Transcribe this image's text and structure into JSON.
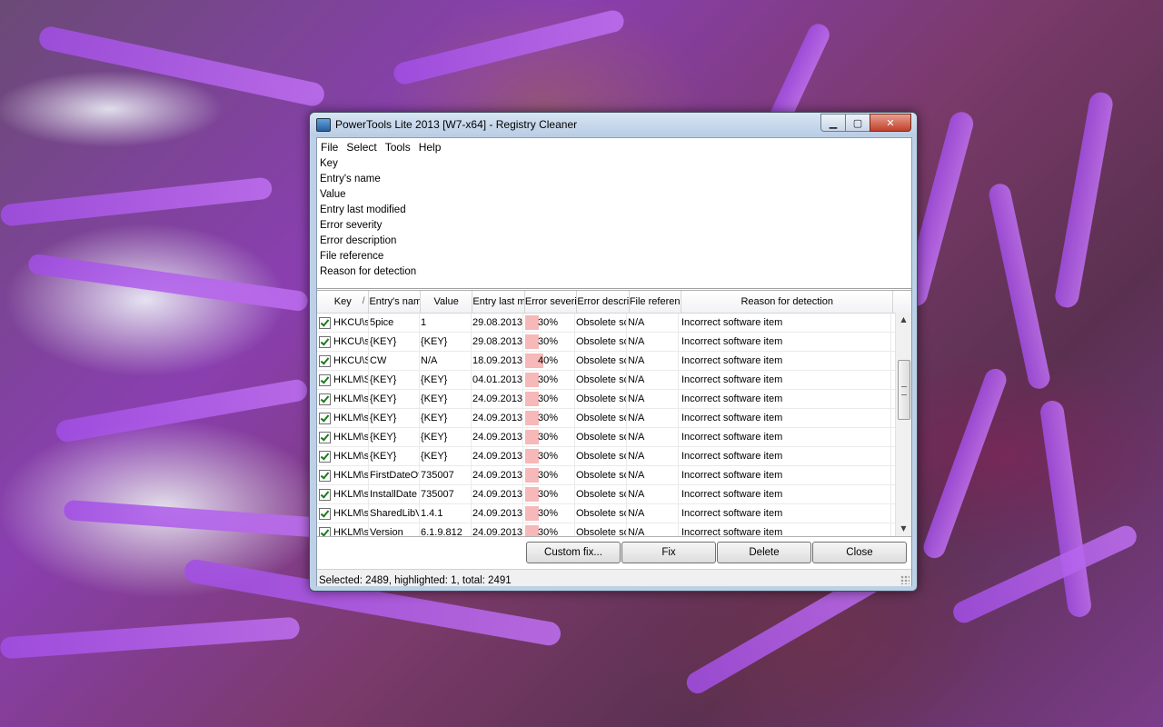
{
  "window": {
    "title": "PowerTools Lite 2013 [W7-x64] - Registry Cleaner",
    "minimize": "▁",
    "maximize": "▢",
    "close": "✕"
  },
  "menu": [
    {
      "label": "File"
    },
    {
      "label": "Select"
    },
    {
      "label": "Tools"
    },
    {
      "label": "Help"
    }
  ],
  "details": [
    "Key",
    "Entry's name",
    "Value",
    "Entry last modified",
    "Error severity",
    "Error description",
    "File reference",
    "Reason for detection"
  ],
  "grid": {
    "columns": [
      {
        "label": "Key",
        "sorted": true
      },
      {
        "label": "Entry's name"
      },
      {
        "label": "Value"
      },
      {
        "label": "Entry last modified"
      },
      {
        "label": "Error severity"
      },
      {
        "label": "Error description"
      },
      {
        "label": "File reference"
      },
      {
        "label": "Reason for detection"
      }
    ],
    "sort_arrow": "/",
    "rows": [
      {
        "key": "HKCU\\software",
        "name": "5pice",
        "value": "1",
        "modified": "29.08.2013",
        "severity": "30%",
        "severity_pct": 30,
        "desc": "Obsolete software",
        "file": "N/A",
        "reason": "Incorrect software item"
      },
      {
        "key": "HKCU\\software",
        "name": "{KEY}",
        "value": "{KEY}",
        "modified": "29.08.2013",
        "severity": "30%",
        "severity_pct": 30,
        "desc": "Obsolete software",
        "file": "N/A",
        "reason": "Incorrect software item"
      },
      {
        "key": "HKCU\\Software",
        "name": "CW",
        "value": "N/A",
        "modified": "18.09.2013",
        "severity": "40%",
        "severity_pct": 40,
        "desc": "Obsolete software",
        "file": "N/A",
        "reason": "Incorrect software item"
      },
      {
        "key": "HKLM\\Software",
        "name": "{KEY}",
        "value": "{KEY}",
        "modified": "04.01.2013",
        "severity": "30%",
        "severity_pct": 30,
        "desc": "Obsolete software",
        "file": "N/A",
        "reason": "Incorrect software item"
      },
      {
        "key": "HKLM\\software",
        "name": "{KEY}",
        "value": "{KEY}",
        "modified": "24.09.2013",
        "severity": "30%",
        "severity_pct": 30,
        "desc": "Obsolete software",
        "file": "N/A",
        "reason": "Incorrect software item"
      },
      {
        "key": "HKLM\\software",
        "name": "{KEY}",
        "value": "{KEY}",
        "modified": "24.09.2013",
        "severity": "30%",
        "severity_pct": 30,
        "desc": "Obsolete software",
        "file": "N/A",
        "reason": "Incorrect software item"
      },
      {
        "key": "HKLM\\software",
        "name": "{KEY}",
        "value": "{KEY}",
        "modified": "24.09.2013",
        "severity": "30%",
        "severity_pct": 30,
        "desc": "Obsolete software",
        "file": "N/A",
        "reason": "Incorrect software item"
      },
      {
        "key": "HKLM\\software",
        "name": "{KEY}",
        "value": "{KEY}",
        "modified": "24.09.2013",
        "severity": "30%",
        "severity_pct": 30,
        "desc": "Obsolete software",
        "file": "N/A",
        "reason": "Incorrect software item"
      },
      {
        "key": "HKLM\\software",
        "name": "FirstDateOfUse",
        "value": "735007",
        "modified": "24.09.2013",
        "severity": "30%",
        "severity_pct": 30,
        "desc": "Obsolete software",
        "file": "N/A",
        "reason": "Incorrect software item"
      },
      {
        "key": "HKLM\\software",
        "name": "InstallDate",
        "value": "735007",
        "modified": "24.09.2013",
        "severity": "30%",
        "severity_pct": 30,
        "desc": "Obsolete software",
        "file": "N/A",
        "reason": "Incorrect software item"
      },
      {
        "key": "HKLM\\software",
        "name": "SharedLibVersion",
        "value": "1.4.1",
        "modified": "24.09.2013",
        "severity": "30%",
        "severity_pct": 30,
        "desc": "Obsolete software",
        "file": "N/A",
        "reason": "Incorrect software item"
      },
      {
        "key": "HKLM\\software",
        "name": "Version",
        "value": "6.1.9.812",
        "modified": "24.09.2013",
        "severity": "30%",
        "severity_pct": 30,
        "desc": "Obsolete software",
        "file": "N/A",
        "reason": "Incorrect software item"
      }
    ]
  },
  "buttons": {
    "custom_fix": "Custom fix...",
    "fix": "Fix",
    "delete": "Delete",
    "close": "Close"
  },
  "status": "Selected: 2489, highlighted: 1, total: 2491",
  "colors": {
    "severity_bar": "#f6b8b8",
    "check": "#1a7a1a"
  }
}
